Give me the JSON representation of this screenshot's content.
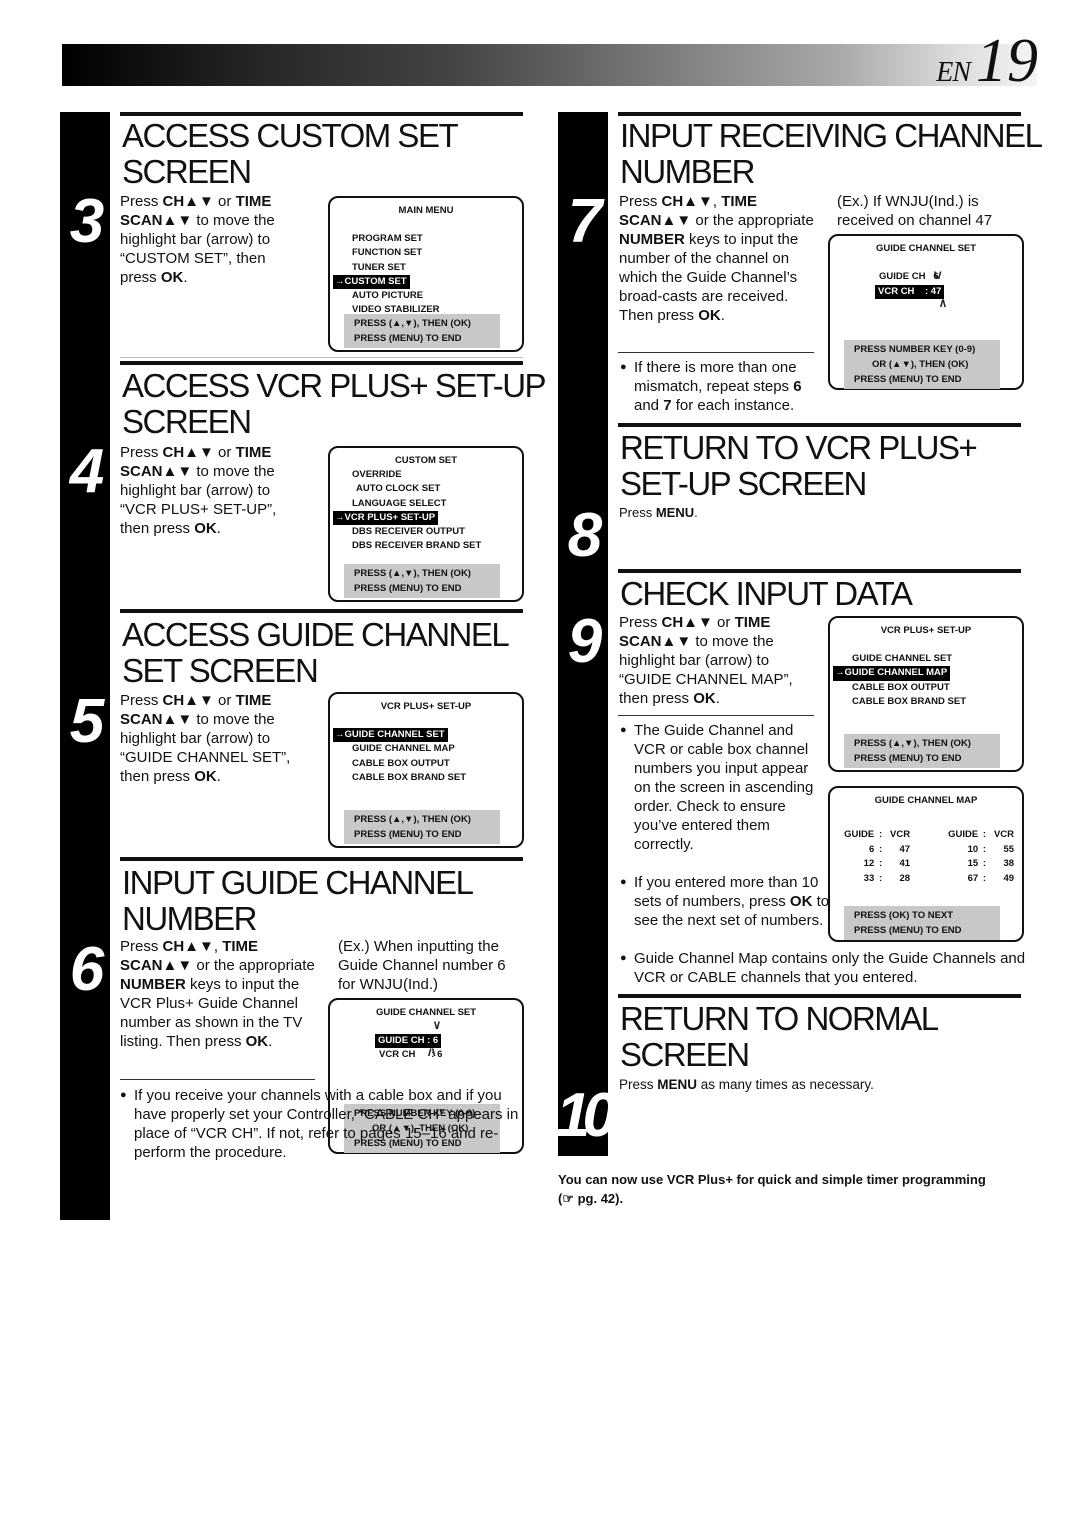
{
  "header": {
    "lang": "EN",
    "page_number": "19"
  },
  "steps": [
    {
      "number": "3",
      "title_lines": [
        "ACCESS CUSTOM SET",
        "SCREEN"
      ],
      "instruction": [
        "Press ",
        {
          "b": "CH▲▼"
        },
        " or ",
        {
          "b": "TIME SCAN▲▼"
        },
        " to move the highlight bar (arrow) to “CUSTOM SET”, then press ",
        {
          "b": "OK"
        },
        "."
      ],
      "osd": {
        "title": "MAIN MENU",
        "items": [
          "PROGRAM SET",
          "FUNCTION SET",
          "TUNER SET",
          "CUSTOM SET",
          "AUTO PICTURE",
          "VIDEO STABILIZER"
        ],
        "selected": "CUSTOM SET",
        "press_lines": [
          "PRESS (▲,▼), THEN (OK)",
          "PRESS (MENU) TO END"
        ]
      }
    },
    {
      "number": "4",
      "title_lines": [
        "ACCESS VCR PLUS+ SET-UP",
        "SCREEN"
      ],
      "instruction": [
        "Press ",
        {
          "b": "CH▲▼"
        },
        " or ",
        {
          "b": "TIME SCAN▲▼"
        },
        " to move the highlight bar (arrow) to “VCR PLUS+ SET-UP”, then press ",
        {
          "b": "OK"
        },
        "."
      ],
      "osd": {
        "title": "CUSTOM SET",
        "items": [
          "OVERRIDE",
          "AUTO CLOCK SET",
          "LANGUAGE SELECT",
          "VCR PLUS+ SET-UP",
          "DBS RECEIVER OUTPUT",
          "DBS RECEIVER BRAND SET"
        ],
        "selected": "VCR PLUS+ SET-UP",
        "press_lines": [
          "PRESS (▲,▼), THEN (OK)",
          "PRESS (MENU) TO END"
        ]
      }
    },
    {
      "number": "5",
      "title_lines": [
        "ACCESS GUIDE CHANNEL",
        "SET SCREEN"
      ],
      "instruction": [
        "Press ",
        {
          "b": "CH▲▼"
        },
        " or ",
        {
          "b": "TIME SCAN▲▼"
        },
        " to move the highlight bar (arrow) to “GUIDE CHANNEL SET”, then press ",
        {
          "b": "OK"
        },
        "."
      ],
      "osd": {
        "title": "VCR PLUS+ SET-UP",
        "items": [
          "GUIDE CHANNEL SET",
          "GUIDE CHANNEL MAP",
          "CABLE BOX OUTPUT",
          "CABLE BOX BRAND SET"
        ],
        "selected": "GUIDE CHANNEL SET",
        "press_lines": [
          "PRESS (▲,▼), THEN (OK)",
          "PRESS (MENU) TO END"
        ]
      }
    },
    {
      "number": "6",
      "title_lines": [
        "INPUT GUIDE CHANNEL",
        "NUMBER"
      ],
      "instruction": [
        "Press ",
        {
          "b": "CH▲▼"
        },
        ", ",
        {
          "b": "TIME SCAN▲▼"
        },
        " or the appropriate ",
        {
          "b": "NUMBER"
        },
        " keys to input the VCR Plus+ Guide Channel number as shown in the TV listing. Then press ",
        {
          "b": "OK"
        },
        "."
      ],
      "example": "(Ex.) When inputting the Guide Channel number 6 for WNJU(Ind.)",
      "osd": {
        "title": "GUIDE CHANNEL SET",
        "guide_ch_label": "GUIDE CH",
        "guide_ch_value": ": 6",
        "vcr_ch_label": "VCR CH",
        "vcr_ch_value": ": 6",
        "highlighted": "GUIDE CH",
        "press_lines": [
          "PRESS NUMBER KEY (0-9)",
          "OR (▲▼),  THEN (OK)",
          "PRESS (MENU) TO END"
        ]
      },
      "note": "If you receive your channels with a cable box and if you have properly set your Controller, “CABLE CH” appears in place of “VCR CH”. If not, refer to pages 15–16 and re-perform the procedure."
    },
    {
      "number": "7",
      "title_lines": [
        "INPUT RECEIVING CHANNEL",
        "NUMBER"
      ],
      "instruction": [
        "Press ",
        {
          "b": "CH▲▼"
        },
        ", ",
        {
          "b": "TIME SCAN▲▼"
        },
        " or the appropriate ",
        {
          "b": "NUMBER"
        },
        " keys to input the number of the channel on which the Guide Channel’s broad-casts are received. Then press ",
        {
          "b": "OK"
        },
        "."
      ],
      "example": "(Ex.) If WNJU(Ind.) is received on channel 47",
      "osd": {
        "title": "GUIDE CHANNEL SET",
        "guide_ch_label": "GUIDE CH",
        "guide_ch_value": "6",
        "vcr_ch_label": "VCR CH",
        "vcr_ch_value": ": 47",
        "highlighted": "VCR CH",
        "press_lines": [
          "PRESS NUMBER KEY (0-9)",
          "OR (▲▼),  THEN (OK)",
          "PRESS (MENU) TO END"
        ]
      },
      "note": [
        "If there is more than one mismatch, repeat steps ",
        {
          "b": "6"
        },
        " and ",
        {
          "b": "7"
        },
        " for each instance."
      ]
    },
    {
      "number": "8",
      "title_lines": [
        "RETURN TO VCR PLUS+",
        "SET-UP SCREEN"
      ],
      "instruction": [
        "Press ",
        {
          "b": "MENU"
        },
        "."
      ]
    },
    {
      "number": "9",
      "title_lines": [
        "CHECK INPUT DATA"
      ],
      "instruction": [
        "Press ",
        {
          "b": "CH▲▼"
        },
        " or ",
        {
          "b": "TIME SCAN▲▼"
        },
        " to move the highlight bar (arrow) to “GUIDE CHANNEL MAP”, then press ",
        {
          "b": "OK"
        },
        "."
      ],
      "osd": {
        "title": "VCR PLUS+ SET-UP",
        "items": [
          "GUIDE CHANNEL SET",
          "GUIDE CHANNEL MAP",
          "CABLE BOX OUTPUT",
          "CABLE BOX BRAND SET"
        ],
        "selected": "GUIDE CHANNEL MAP",
        "press_lines": [
          "PRESS (▲,▼), THEN (OK)",
          "PRESS (MENU) TO END"
        ]
      },
      "map_osd": {
        "title": "GUIDE CHANNEL MAP",
        "header": [
          "GUIDE",
          ":",
          "VCR",
          "GUIDE",
          ":",
          "VCR"
        ],
        "rows": [
          [
            "6",
            "47",
            "10",
            "55"
          ],
          [
            "12",
            "41",
            "15",
            "38"
          ],
          [
            "33",
            "28",
            "67",
            "49"
          ]
        ],
        "press_lines": [
          "PRESS (OK) TO NEXT",
          "PRESS (MENU) TO END"
        ]
      },
      "notes": [
        "The Guide Channel and VCR or cable box channel numbers you input appear on the screen in ascending order. Check to ensure you’ve entered them correctly.",
        [
          "If you entered more than 10 sets of numbers, press ",
          {
            "b": "OK"
          },
          " to see the next set of numbers."
        ],
        "Guide Channel Map contains only the Guide Channels and VCR or CABLE channels that you entered."
      ]
    },
    {
      "number": "10",
      "title_lines": [
        "RETURN TO NORMAL",
        "SCREEN"
      ],
      "instruction": [
        "Press ",
        {
          "b": "MENU"
        },
        " as many times as necessary."
      ]
    }
  ],
  "closing": "You can now use VCR Plus+ for quick and simple timer programming (☞ pg. 42)."
}
